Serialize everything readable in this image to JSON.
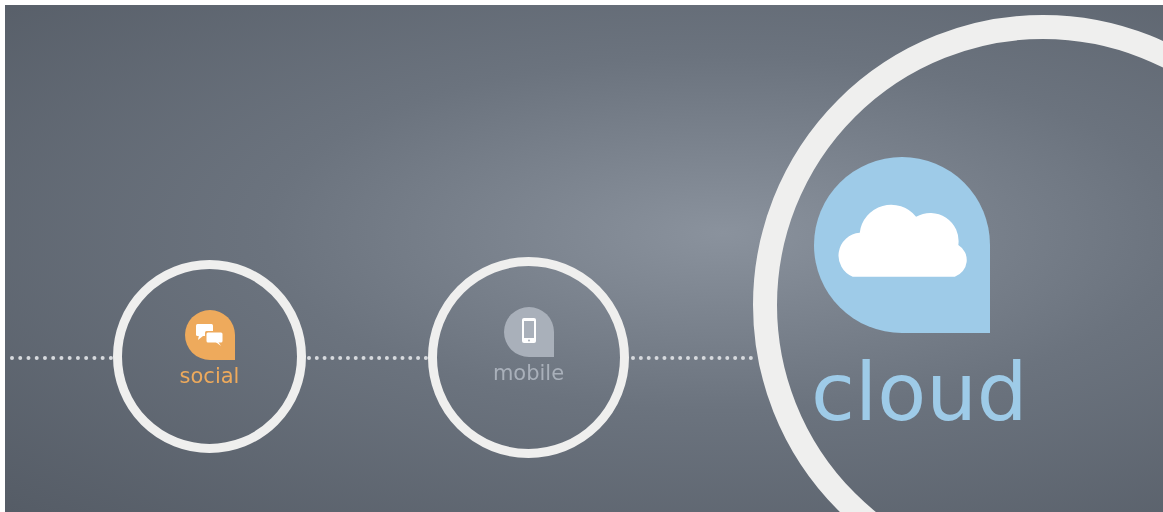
{
  "nodes": [
    {
      "kind": "social",
      "label": "social",
      "color": "#eeaa5c"
    },
    {
      "kind": "mobile",
      "label": "mobile",
      "color": "#a9b0ba"
    },
    {
      "kind": "cloud",
      "label": "cloud",
      "color": "#9ecbe8"
    }
  ]
}
